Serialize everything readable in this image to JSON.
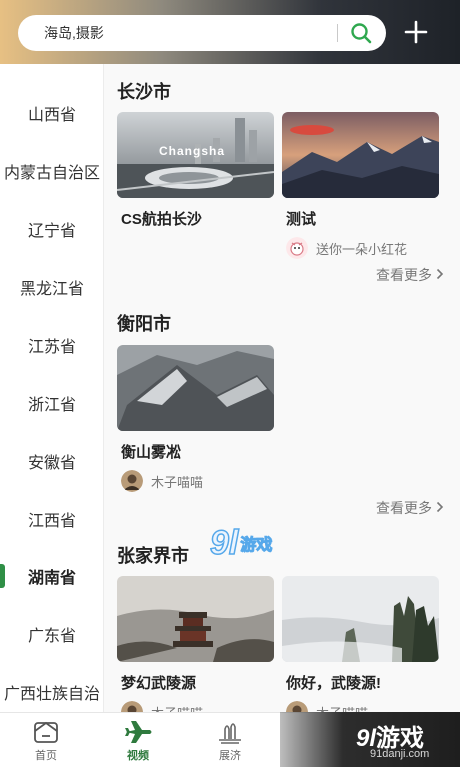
{
  "search": {
    "placeholder": "海岛,摄影"
  },
  "sidebar": {
    "items": [
      {
        "label": "山西省"
      },
      {
        "label": "内蒙古自治区"
      },
      {
        "label": "辽宁省"
      },
      {
        "label": "黑龙江省"
      },
      {
        "label": "江苏省"
      },
      {
        "label": "浙江省"
      },
      {
        "label": "安徽省"
      },
      {
        "label": "江西省"
      },
      {
        "label": "湖南省"
      },
      {
        "label": "广东省"
      },
      {
        "label": "广西壮族自治"
      }
    ],
    "active": "湖南省"
  },
  "sections": [
    {
      "city": "长沙市",
      "cards": [
        {
          "title": "CS航拍长沙",
          "overlay": "Changsha"
        },
        {
          "title": "测试",
          "author": "送你一朵小红花"
        }
      ],
      "more": "查看更多"
    },
    {
      "city": "衡阳市",
      "cards": [
        {
          "title": "衡山雾凇",
          "author": "木子喵喵"
        }
      ],
      "more": "查看更多"
    },
    {
      "city": "张家界市",
      "cards": [
        {
          "title": "梦幻武陵源",
          "author": "木子喵喵"
        },
        {
          "title": "你好，武陵源!",
          "author": "木子喵喵"
        }
      ]
    }
  ],
  "tabs": [
    {
      "label": "首页",
      "icon": "home-icon"
    },
    {
      "label": "视频",
      "icon": "airplane-icon",
      "active": true
    },
    {
      "label": "展济",
      "icon": "exhibition-icon"
    }
  ],
  "watermark": {
    "brand_num": "9l",
    "brand_text": "游戏",
    "url": "91danji.com"
  },
  "colors": {
    "accent": "#2f8f46",
    "search_icon": "#2fa84f"
  }
}
